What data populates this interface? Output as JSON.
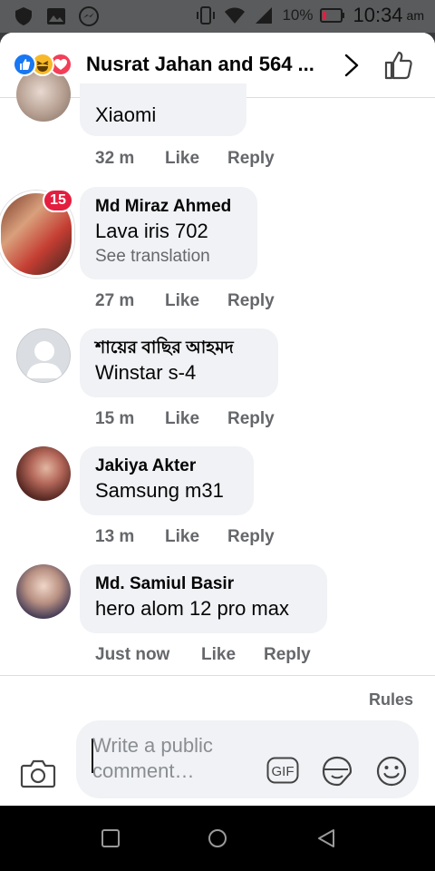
{
  "status_bar": {
    "battery_percent": "10%",
    "time": "10:34",
    "ampm": "am"
  },
  "header": {
    "title": "Nusrat Jahan and 564 ...",
    "reactions": [
      "like-reaction-icon",
      "haha-reaction-icon",
      "love-reaction-icon"
    ]
  },
  "comments": [
    {
      "name": "",
      "text": "Xiaomi",
      "time": "32 m",
      "like": "Like",
      "reply": "Reply"
    },
    {
      "name": "Md Miraz Ahmed",
      "text": "Lava iris 702",
      "translation": "See translation",
      "time": "27 m",
      "like": "Like",
      "reply": "Reply",
      "badge": "15"
    },
    {
      "name": "শায়ের বাছির আহমদ",
      "text": "Winstar s-4",
      "time": "15 m",
      "like": "Like",
      "reply": "Reply"
    },
    {
      "name": "Jakiya Akter",
      "text": "Samsung m31",
      "time": "13 m",
      "like": "Like",
      "reply": "Reply"
    },
    {
      "name": "Md. Samiul Basir",
      "text": "hero alom 12 pro max",
      "time": "Just now",
      "like": "Like",
      "reply": "Reply"
    }
  ],
  "composer": {
    "rules": "Rules",
    "placeholder": "Write a public comment…",
    "gif_label": "GIF"
  },
  "colors": {
    "brand_blue": "#1877f2",
    "bubble_bg": "#f0f2f5",
    "secondary_text": "#65676b",
    "badge_red": "#e41e3f"
  }
}
